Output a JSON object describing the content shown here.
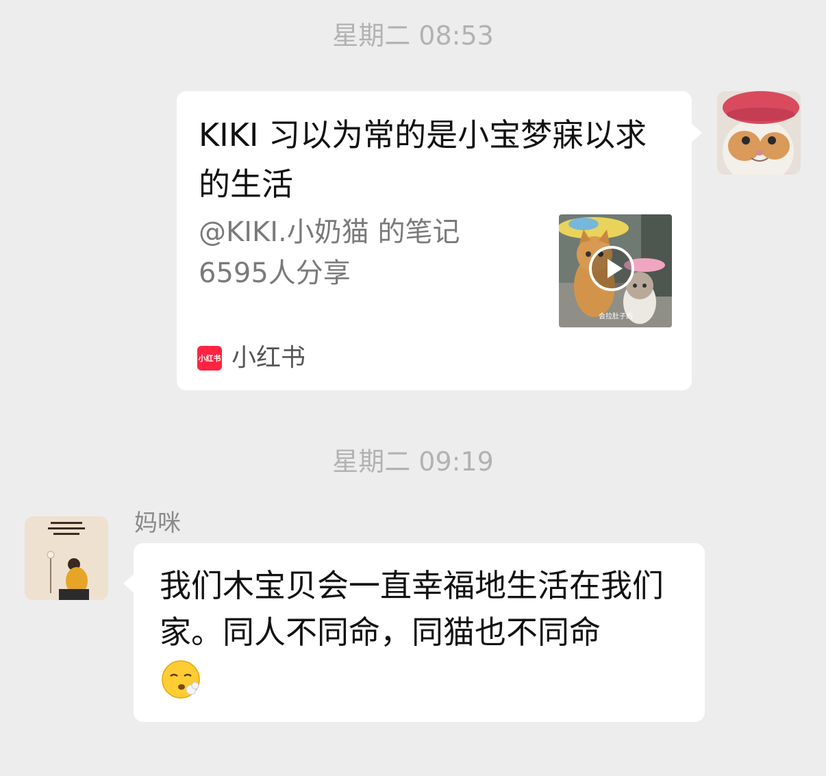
{
  "timestamps": [
    "星期二 08:53",
    "星期二 09:19"
  ],
  "share_card": {
    "title": "KIKI 习以为常的是小宝梦寐以求的生活",
    "author": "@KIKI.小奶猫 的笔记",
    "shares": "6595人分享",
    "thumbnail_caption": "会拉肚子的",
    "source_logo_text": "小红书",
    "source_name": "小红书",
    "source_color": "#ff2442"
  },
  "incoming": {
    "sender": "妈咪",
    "message": "我们木宝贝会一直幸福地生活在我们家。同人不同命，同猫也不同命",
    "emoji": "face-exhaling-icon",
    "avatar_text": "安稳于日常\n汝喜于光阴\n悦己阅己"
  },
  "colors": {
    "background": "#ededed",
    "bubble": "#ffffff",
    "timestamp": "#b2b2b2"
  }
}
